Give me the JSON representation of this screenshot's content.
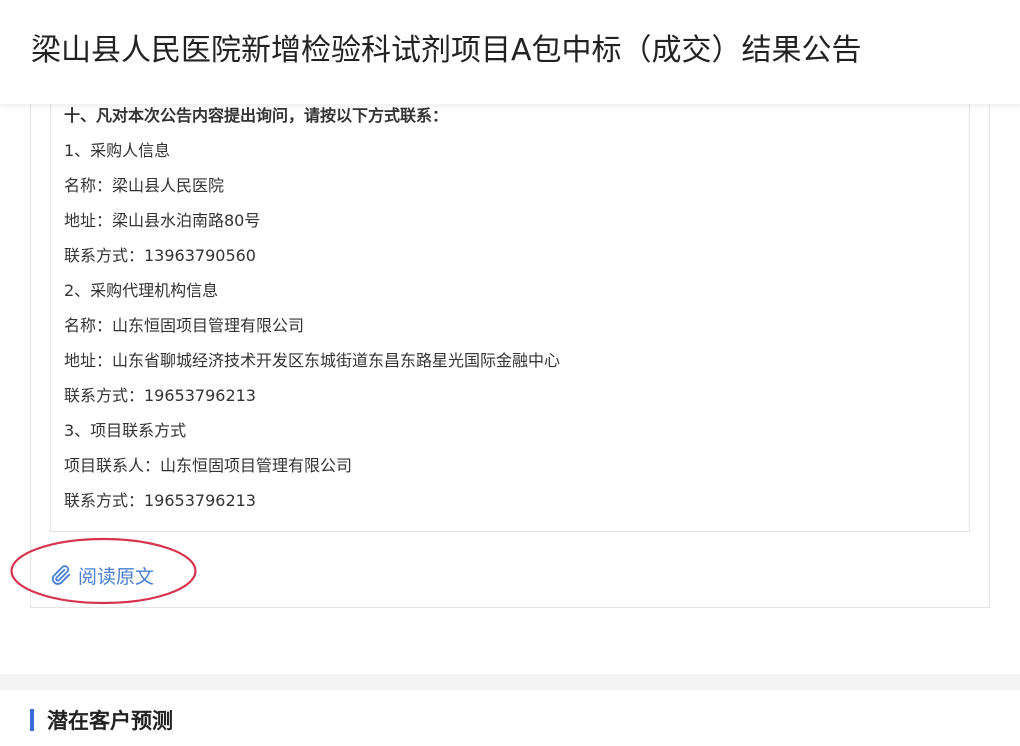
{
  "header": {
    "title": "梁山县人民医院新增检验科试剂项目A包中标（成交）结果公告"
  },
  "notice": {
    "lines": [
      "十、凡对本次公告内容提出询问，请按以下方式联系：",
      "1、采购人信息",
      "名称：梁山县人民医院",
      "地址：梁山县水泊南路80号",
      "联系方式：13963790560",
      "2、采购代理机构信息",
      "名称：山东恒固项目管理有限公司",
      "地址：山东省聊城经济技术开发区东城街道东昌东路星光国际金融中心",
      "联系方式：19653796213",
      "3、项目联系方式",
      "项目联系人：山东恒固项目管理有限公司",
      "联系方式：19653796213"
    ]
  },
  "actions": {
    "read_original_label": "阅读原文",
    "icon": "paperclip-icon",
    "highlight_color": "#d6334f",
    "link_color": "#4a7fd6"
  },
  "section": {
    "title": "潜在客户预测",
    "accent_color": "#3b6fe0"
  }
}
